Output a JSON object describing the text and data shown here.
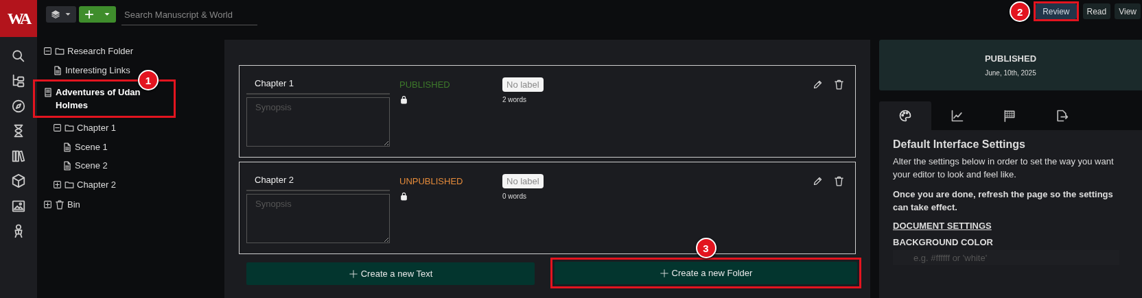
{
  "logo": "WA",
  "toolbar": {
    "search": {
      "placeholder": "Search Manuscript & World"
    }
  },
  "view_buttons": [
    {
      "label": "Review",
      "selected": true,
      "callout": "2"
    },
    {
      "label": "Read",
      "selected": false
    },
    {
      "label": "View",
      "selected": false
    }
  ],
  "tree": [
    {
      "kind": "folder",
      "label": "Research Folder",
      "expanded": true,
      "children": [
        {
          "kind": "document",
          "label": "Interesting Links"
        }
      ]
    },
    {
      "kind": "manuscript",
      "label": "Adventures of Udan Holmes",
      "callout": "1",
      "children": [
        {
          "kind": "folder",
          "label": "Chapter 1",
          "expanded": true,
          "children": [
            {
              "kind": "document",
              "label": "Scene 1"
            },
            {
              "kind": "document",
              "label": "Scene 2"
            }
          ]
        },
        {
          "kind": "folder",
          "label": "Chapter 2",
          "expanded": false
        }
      ]
    },
    {
      "kind": "bin",
      "label": "Bin",
      "expanded": false
    }
  ],
  "cards": [
    {
      "title": "Chapter 1",
      "synopsis": {
        "placeholder": "Synopsis"
      },
      "status": "PUBLISHED",
      "kind": "published",
      "locked": true,
      "label": "No label",
      "words": "2 words"
    },
    {
      "title": "Chapter 2",
      "synopsis": {
        "placeholder": "Synopsis"
      },
      "status": "UNPUBLISHED",
      "kind": "unpublished",
      "locked": true,
      "label": "No label",
      "words": "0 words"
    }
  ],
  "create_buttons": [
    {
      "label": "Create a new Text"
    },
    {
      "label": "Create a new Folder",
      "callout": "3"
    }
  ],
  "publish_box": {
    "status": "PUBLISHED",
    "date": "June, 10th, 2025"
  },
  "settings_tabs": [
    {
      "selected": true
    },
    {
      "selected": false
    },
    {
      "selected": false
    },
    {
      "selected": false
    }
  ],
  "settings": {
    "title": "Default Interface Settings",
    "intro": "Alter the settings below in order to set the way you want your editor to look and feel like.",
    "note": "Once you are done, refresh the page so the settings can take effect.",
    "section": "DOCUMENT SETTINGS",
    "field_label": "BACKGROUND COLOR",
    "field": {
      "placeholder": "e.g. #ffffff or 'white'"
    }
  }
}
